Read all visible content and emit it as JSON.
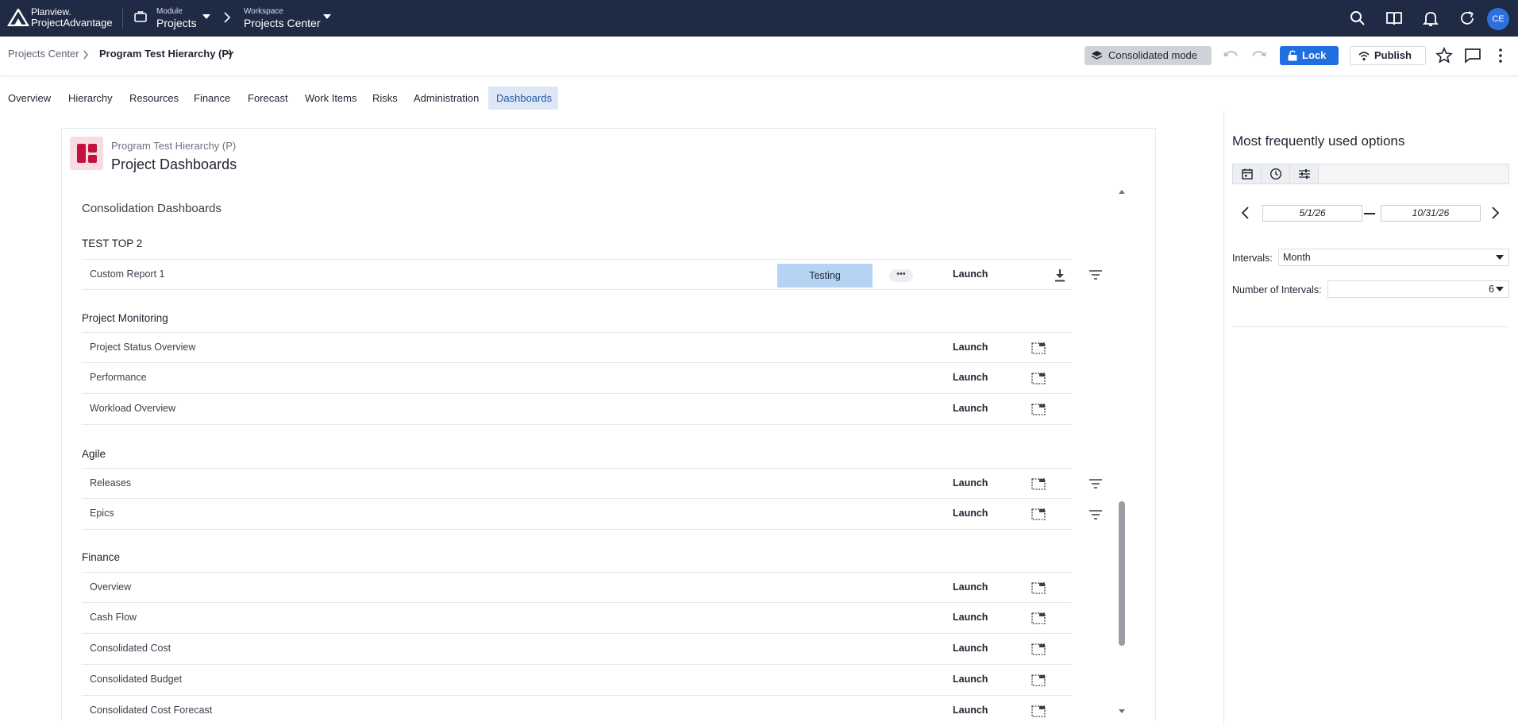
{
  "topbar": {
    "brand_line1": "Planview.",
    "brand_line2": "ProjectAdvantage",
    "module_caption": "Module",
    "module_value": "Projects",
    "workspace_caption": "Workspace",
    "workspace_value": "Projects Center",
    "avatar_initials": "CE",
    "icons": [
      "search-icon",
      "book-icon",
      "bell-icon",
      "refresh-icon"
    ],
    "bg_color": "#1f2a44"
  },
  "breadcrumb": {
    "root": "Projects Center",
    "current": "Program Test Hierarchy (P)"
  },
  "toolbar": {
    "consolidated_label": "Consolidated mode",
    "lock_label": "Lock",
    "publish_label": "Publish",
    "lock_color": "#1f6fe0"
  },
  "tabs": [
    "Overview",
    "Hierarchy",
    "Resources",
    "Finance",
    "Forecast",
    "Work Items",
    "Risks",
    "Administration",
    "Dashboards"
  ],
  "active_tab": "Dashboards",
  "card": {
    "subtitle": "Program Test Hierarchy (P)",
    "title": "Project Dashboards",
    "icon_color": "#c2123d"
  },
  "dashboards": {
    "heading": "Consolidation Dashboards",
    "sections": [
      {
        "title": "TEST TOP 2",
        "items": [
          {
            "name": "Custom Report 1",
            "tag": "Testing",
            "more": "•••",
            "launch": "Launch",
            "icon": "download-icon",
            "filter": true
          }
        ]
      },
      {
        "title": "Project Monitoring",
        "items": [
          {
            "name": "Project Status Overview",
            "launch": "Launch",
            "icon": "frame-icon",
            "filter": false
          },
          {
            "name": "Performance",
            "launch": "Launch",
            "icon": "frame-icon",
            "filter": false
          },
          {
            "name": "Workload Overview",
            "launch": "Launch",
            "icon": "frame-icon",
            "filter": false
          }
        ]
      },
      {
        "title": "Agile",
        "items": [
          {
            "name": "Releases",
            "launch": "Launch",
            "icon": "frame-icon",
            "filter": true
          },
          {
            "name": "Epics",
            "launch": "Launch",
            "icon": "frame-icon",
            "filter": true
          }
        ]
      },
      {
        "title": "Finance",
        "items": [
          {
            "name": "Overview",
            "launch": "Launch",
            "icon": "frame-icon",
            "filter": false
          },
          {
            "name": "Cash Flow",
            "launch": "Launch",
            "icon": "frame-icon",
            "filter": false
          },
          {
            "name": "Consolidated Cost",
            "launch": "Launch",
            "icon": "frame-icon",
            "filter": false
          },
          {
            "name": "Consolidated Budget",
            "launch": "Launch",
            "icon": "frame-icon",
            "filter": false
          },
          {
            "name": "Consolidated Cost Forecast",
            "launch": "Launch",
            "icon": "frame-icon",
            "filter": false
          }
        ]
      }
    ]
  },
  "right_panel": {
    "title": "Most frequently used options",
    "tab_icons": [
      "calendar-icon",
      "clock-icon",
      "sliders-icon"
    ],
    "date_from": "5/1/26",
    "date_to": "10/31/26",
    "intervals_label": "Intervals:",
    "intervals_value": "Month",
    "num_intervals_label": "Number of Intervals:",
    "num_intervals_value": "6"
  }
}
